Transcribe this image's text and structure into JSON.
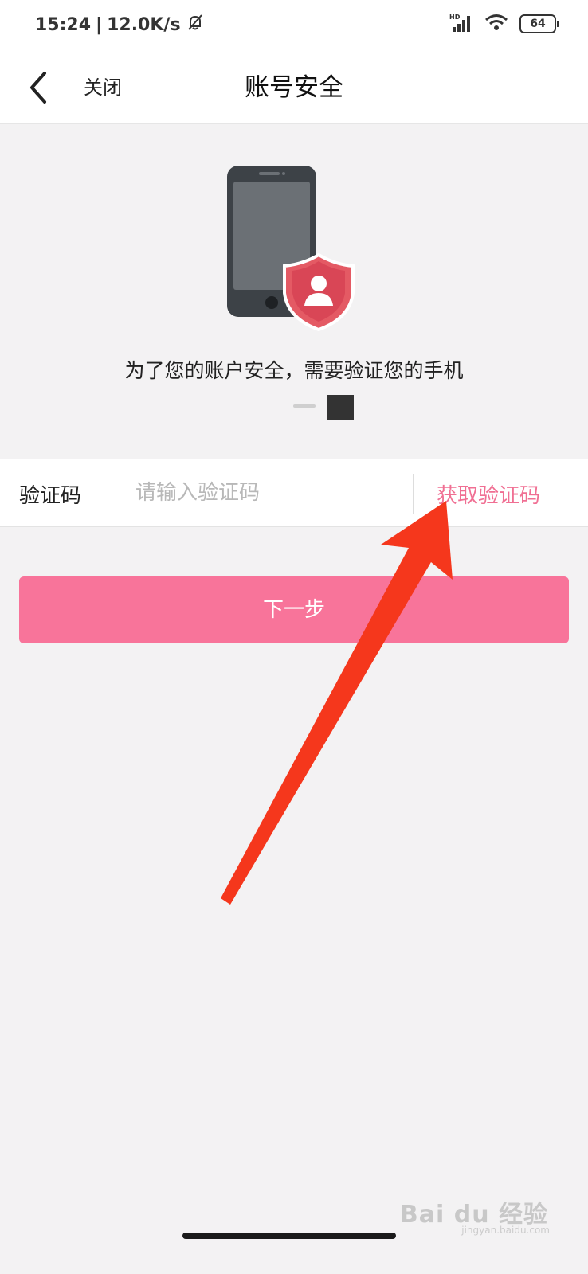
{
  "status_bar": {
    "time": "15:24",
    "separator": "|",
    "net_speed": "12.0K/s",
    "signal_label": "HD",
    "battery": "64"
  },
  "nav": {
    "close_label": "关闭",
    "title": "账号安全"
  },
  "hero": {
    "description": "为了您的账户安全，需要验证您的手机"
  },
  "verify": {
    "label": "验证码",
    "placeholder": "请输入验证码",
    "get_code_label": "获取验证码"
  },
  "next_button": {
    "label": "下一步"
  },
  "watermark": {
    "brand": "Bai du 经验",
    "url": "jingyan.baidu.com"
  },
  "colors": {
    "accent": "#f06f93",
    "button": "#f8749a",
    "background": "#f3f2f3",
    "annotation_arrow": "#f5371c",
    "shield": "#e45a64"
  },
  "icons": [
    "back-chevron-icon",
    "mute-bell-icon",
    "signal-icon",
    "wifi-icon",
    "battery-icon",
    "phone-shield-illustration",
    "annotation-arrow"
  ]
}
